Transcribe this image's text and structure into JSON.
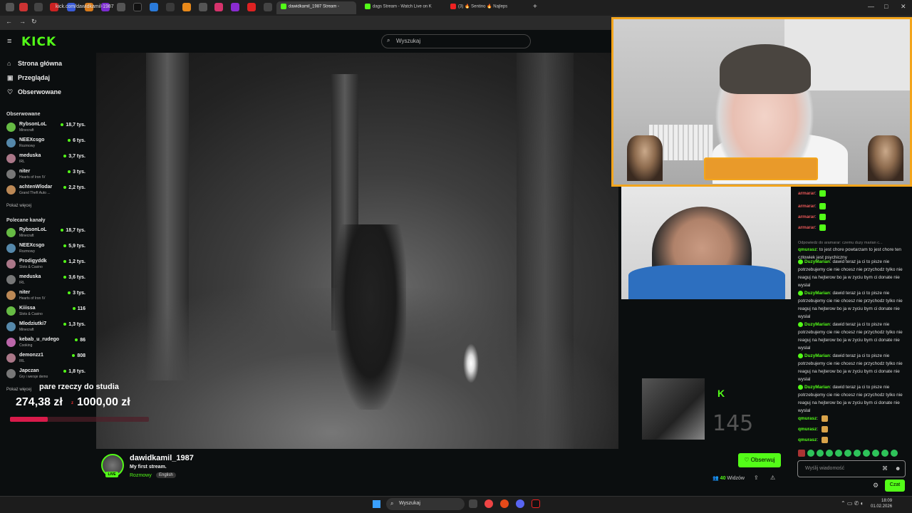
{
  "browser": {
    "tabs": [
      {
        "label": "dawidkamil_1987 Stream -",
        "active": true
      },
      {
        "label": "dags Stream - Watch Live on K",
        "active": false
      },
      {
        "label": "(3) 🔥 Sentino 🔥 Najleps",
        "active": false
      }
    ],
    "url": "kick.com/dawidkamil-1987",
    "window_controls": [
      "—",
      "□",
      "✕"
    ]
  },
  "header": {
    "logo": "KICK",
    "search_placeholder": "Wyszukaj"
  },
  "sidebar": {
    "nav": [
      {
        "label": "Strona główna",
        "icon": "home-icon"
      },
      {
        "label": "Przeglądaj",
        "icon": "browse-icon"
      },
      {
        "label": "Obserwowane",
        "icon": "heart-icon"
      }
    ],
    "followed_title": "Obserwowane",
    "followed": [
      {
        "name": "RybsonLoL",
        "category": "Minecraft",
        "viewers": "18,7 tys."
      },
      {
        "name": "NEEXcsgo",
        "category": "Rozmowy",
        "viewers": "6 tys."
      },
      {
        "name": "meduska",
        "category": "IRL",
        "viewers": "3,7 tys."
      },
      {
        "name": "niter",
        "category": "Hearts of Iron IV",
        "viewers": "3 tys."
      },
      {
        "name": "achtenWlodar",
        "category": "Grand Theft Auto ...",
        "viewers": "2,2 tys."
      }
    ],
    "show_more_1": "Pokaż więcej",
    "recommended_title": "Polecane kanały",
    "recommended": [
      {
        "name": "RybsonLoL",
        "category": "Minecraft",
        "viewers": "18,7 tys."
      },
      {
        "name": "NEEXcsgo",
        "category": "Rozmowy",
        "viewers": "5,9 tys."
      },
      {
        "name": "Prodigyddk",
        "category": "Slots & Casino",
        "viewers": "1,2 tys."
      },
      {
        "name": "meduska",
        "category": "IRL",
        "viewers": "3,6 tys."
      },
      {
        "name": "niter",
        "category": "Hearts of Iron IV",
        "viewers": "3 tys."
      },
      {
        "name": "Kiiissa",
        "category": "Slots & Casino",
        "viewers": "116"
      },
      {
        "name": "Mlodziutki7",
        "category": "Minecraft",
        "viewers": "1,3 tys."
      },
      {
        "name": "kebab_u_rudego",
        "category": "Cooking",
        "viewers": "86"
      },
      {
        "name": "demonzz1",
        "category": "IRL",
        "viewers": "808"
      },
      {
        "name": "Japczan",
        "category": "Gry i wersje demo",
        "viewers": "1,8 tys."
      }
    ],
    "show_more_2": "Pokaż więcej"
  },
  "goal": {
    "title": "pare rzeczy do studia",
    "current": "274,38 zł",
    "separator": "z",
    "target": "1000,00 zł",
    "progress": 0.274
  },
  "overlay": {
    "big_number": "145",
    "k_logo": "K"
  },
  "chat": {
    "messages": [
      {
        "user": "armarar",
        "text": "",
        "user_color": "#e85858",
        "emote": "green"
      },
      {
        "user": "armarar",
        "text": "",
        "user_color": "#e85858",
        "emote": "green"
      },
      {
        "user": "armarar",
        "text": "",
        "user_color": "#e85858",
        "emote": "green"
      },
      {
        "user": "armarar",
        "text": "",
        "user_color": "#e85858",
        "emote": "green"
      },
      {
        "user": "qmurasz",
        "text": "to jest chore powtarzam to jest chore ten człowiek jest psychiczny",
        "user_color": "#53fc18",
        "reply": "Odpowiedz do aramarar: czemu duzy marian c..."
      },
      {
        "user": "DuzyMarian",
        "text": "dawid teraz ja ci to pisze nie potrzebujemy cie nie chcesz nie przychodz tylko nie reaguj na hejterow bo ja w zyciu bym ci donate nie wyslal",
        "user_color": "#53fc18",
        "badge": true
      },
      {
        "user": "DuzyMarian",
        "text": "dawid teraz ja ci to pisze nie potrzebujemy cie nie chcesz nie przychodz tylko nie reaguj na hejterow bo ja w zyciu bym ci donate nie wyslal",
        "user_color": "#53fc18",
        "badge": true
      },
      {
        "user": "DuzyMarian",
        "text": "dawid teraz ja ci to pisze nie potrzebujemy cie nie chcesz nie przychodz tylko nie reaguj na hejterow bo ja w zyciu bym ci donate nie wyslal",
        "user_color": "#53fc18",
        "badge": true
      },
      {
        "user": "DuzyMarian",
        "text": "dawid teraz ja ci to pisze nie potrzebujemy cie nie chcesz nie przychodz tylko nie reaguj na hejterow bo ja w zyciu bym ci donate nie wyslal",
        "user_color": "#53fc18",
        "badge": true
      },
      {
        "user": "DuzyMarian",
        "text": "dawid teraz ja ci to pisze nie potrzebujemy cie nie chcesz nie przychodz tylko nie reaguj na hejterow bo ja w zyciu bym ci donate nie wyslal",
        "user_color": "#53fc18",
        "badge": true
      },
      {
        "user": "qmurasz",
        "text": "",
        "user_color": "#53fc18",
        "emote": "burger"
      },
      {
        "user": "qmurasz",
        "text": "",
        "user_color": "#53fc18",
        "emote": "burger"
      },
      {
        "user": "qmurasz",
        "text": "",
        "user_color": "#53fc18",
        "emote": "burger"
      }
    ],
    "input_placeholder": "Wyślij wiadomość",
    "send_label": "Czat"
  },
  "channel": {
    "name": "dawidkamil_1987",
    "title": "My first stream.",
    "category": "Rozmowy",
    "language": "English",
    "live_label": "LIVE",
    "follow_label": "Obserwuj",
    "viewers_count": "40",
    "viewers_label": "Widzów"
  },
  "taskbar": {
    "search_label": "Wyszukaj",
    "time": "18:09",
    "date": "01.02.2026"
  }
}
